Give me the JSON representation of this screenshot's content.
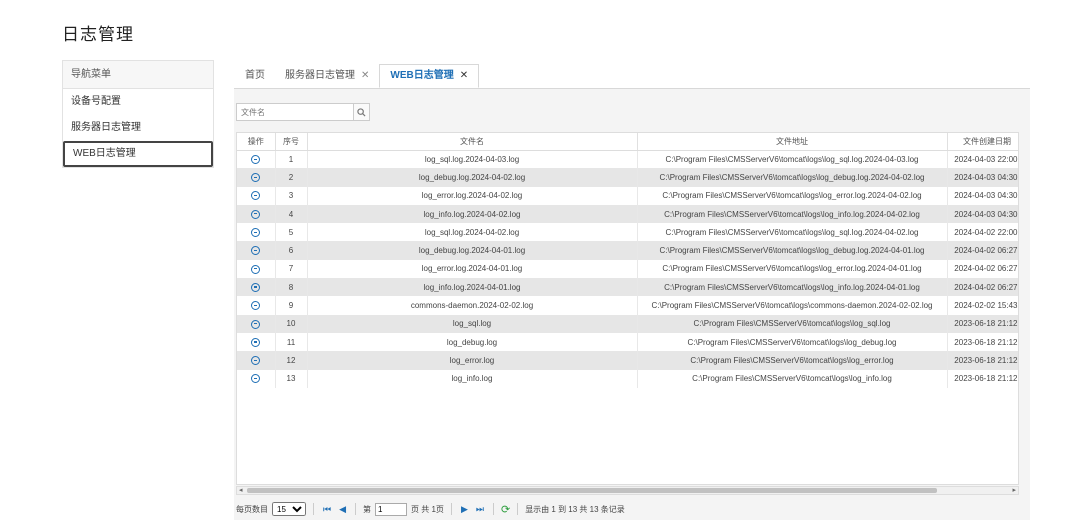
{
  "page": {
    "title": "日志管理"
  },
  "sidebar": {
    "header": "导航菜单",
    "items": [
      {
        "label": "设备号配置"
      },
      {
        "label": "服务器日志管理"
      },
      {
        "label": "WEB日志管理"
      }
    ]
  },
  "tabs": [
    {
      "label": "首页",
      "closable": false
    },
    {
      "label": "服务器日志管理",
      "closable": true
    },
    {
      "label": "WEB日志管理",
      "closable": true,
      "active": true
    }
  ],
  "tab_close_glyph": "✕",
  "search": {
    "placeholder": "文件名",
    "icon": "search-icon"
  },
  "table": {
    "columns": [
      "操作",
      "序号",
      "文件名",
      "文件地址",
      "文件创建日期"
    ],
    "rows": [
      {
        "no": "1",
        "name": "log_sql.log.2024-04-03.log",
        "path": "C:\\Program Files\\CMSServerV6\\tomcat\\logs\\log_sql.log.2024-04-03.log",
        "date": "2024-04-03 22:00:"
      },
      {
        "no": "2",
        "name": "log_debug.log.2024-04-02.log",
        "path": "C:\\Program Files\\CMSServerV6\\tomcat\\logs\\log_debug.log.2024-04-02.log",
        "date": "2024-04-03 04:30:"
      },
      {
        "no": "3",
        "name": "log_error.log.2024-04-02.log",
        "path": "C:\\Program Files\\CMSServerV6\\tomcat\\logs\\log_error.log.2024-04-02.log",
        "date": "2024-04-03 04:30:"
      },
      {
        "no": "4",
        "name": "log_info.log.2024-04-02.log",
        "path": "C:\\Program Files\\CMSServerV6\\tomcat\\logs\\log_info.log.2024-04-02.log",
        "date": "2024-04-03 04:30:"
      },
      {
        "no": "5",
        "name": "log_sql.log.2024-04-02.log",
        "path": "C:\\Program Files\\CMSServerV6\\tomcat\\logs\\log_sql.log.2024-04-02.log",
        "date": "2024-04-02 22:00:"
      },
      {
        "no": "6",
        "name": "log_debug.log.2024-04-01.log",
        "path": "C:\\Program Files\\CMSServerV6\\tomcat\\logs\\log_debug.log.2024-04-01.log",
        "date": "2024-04-02 06:27:"
      },
      {
        "no": "7",
        "name": "log_error.log.2024-04-01.log",
        "path": "C:\\Program Files\\CMSServerV6\\tomcat\\logs\\log_error.log.2024-04-01.log",
        "date": "2024-04-02 06:27:"
      },
      {
        "no": "8",
        "name": "log_info.log.2024-04-01.log",
        "path": "C:\\Program Files\\CMSServerV6\\tomcat\\logs\\log_info.log.2024-04-01.log",
        "date": "2024-04-02 06:27:"
      },
      {
        "no": "9",
        "name": "commons-daemon.2024-02-02.log",
        "path": "C:\\Program Files\\CMSServerV6\\tomcat\\logs\\commons-daemon.2024-02-02.log",
        "date": "2024-02-02 15:43:"
      },
      {
        "no": "10",
        "name": "log_sql.log",
        "path": "C:\\Program Files\\CMSServerV6\\tomcat\\logs\\log_sql.log",
        "date": "2023-06-18 21:12:"
      },
      {
        "no": "11",
        "name": "log_debug.log",
        "path": "C:\\Program Files\\CMSServerV6\\tomcat\\logs\\log_debug.log",
        "date": "2023-06-18 21:12:"
      },
      {
        "no": "12",
        "name": "log_error.log",
        "path": "C:\\Program Files\\CMSServerV6\\tomcat\\logs\\log_error.log",
        "date": "2023-06-18 21:12:"
      },
      {
        "no": "13",
        "name": "log_info.log",
        "path": "C:\\Program Files\\CMSServerV6\\tomcat\\logs\\log_info.log",
        "date": "2023-06-18 21:12:"
      }
    ]
  },
  "pager": {
    "page_size_label": "每页数目",
    "page_size": "15",
    "page_prefix": "第",
    "page_value": "1",
    "page_suffix": "页 共 1页",
    "status": "显示由 1 到 13 共 13 条记录",
    "first_glyph": "⏮",
    "prev_glyph": "◀",
    "next_glyph": "▶",
    "last_glyph": "⏭",
    "refresh_glyph": "⟳"
  },
  "colors": {
    "accent": "#1f6fb5",
    "row_alt": "#e6e6e6",
    "refresh": "#2e9e3e"
  }
}
